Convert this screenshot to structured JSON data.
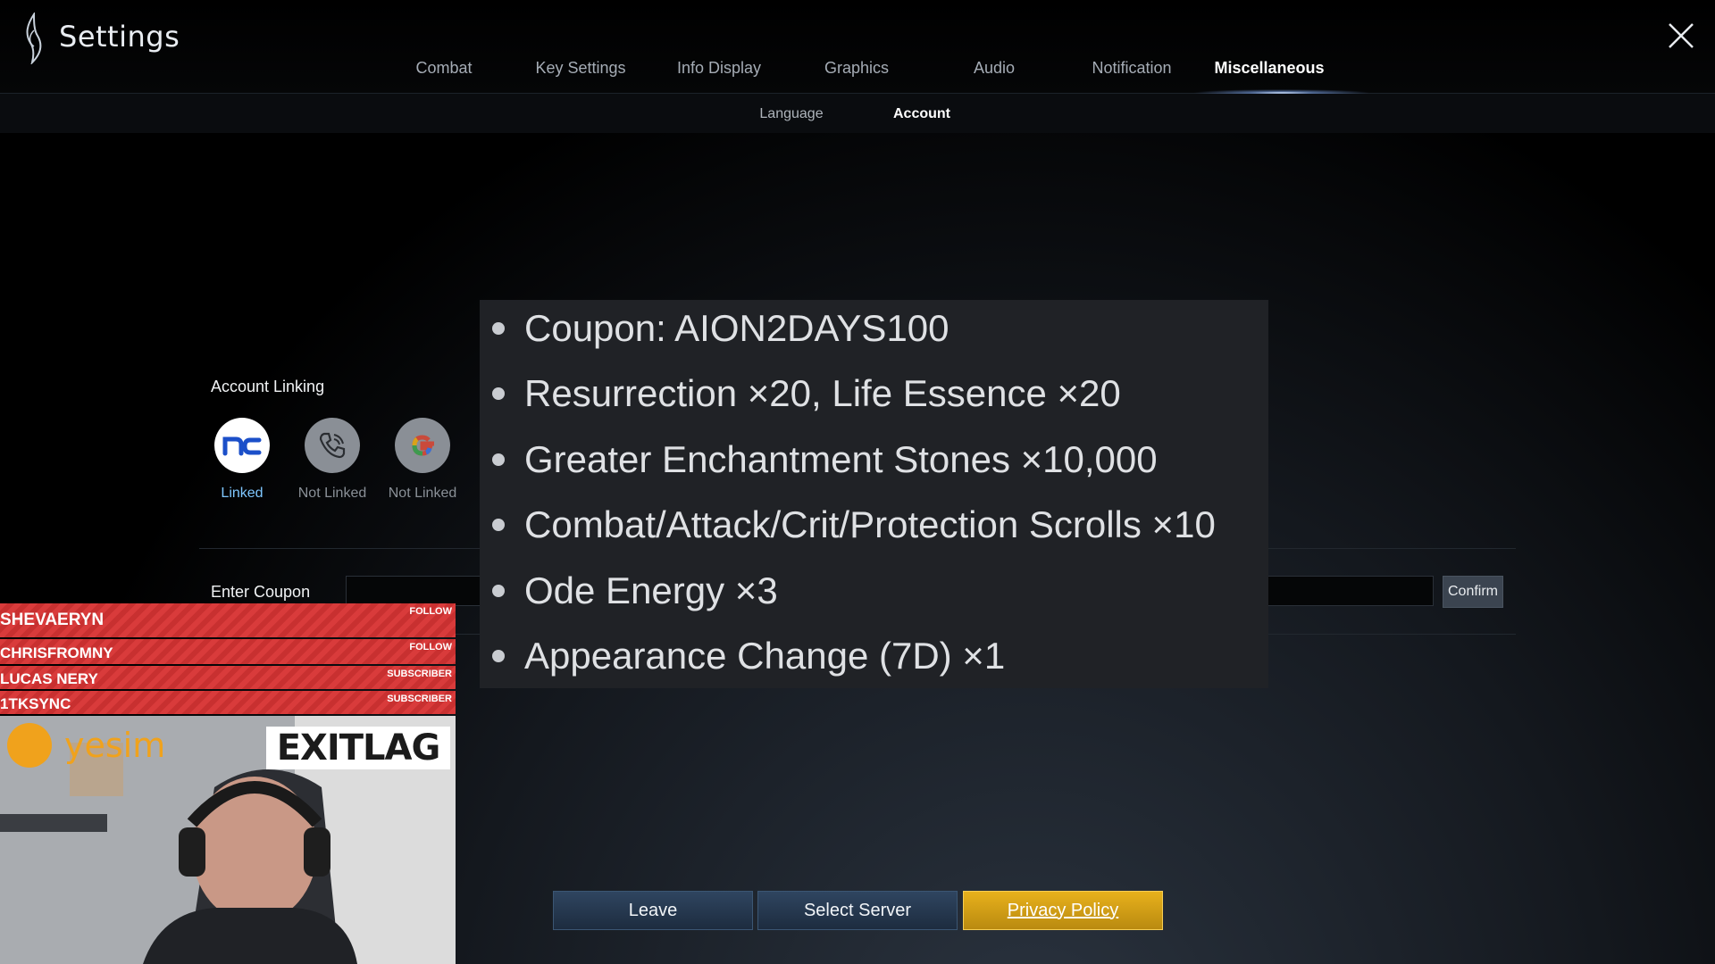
{
  "header": {
    "title": "Settings",
    "tabs": [
      {
        "label": "Combat"
      },
      {
        "label": "Key Settings"
      },
      {
        "label": "Info Display"
      },
      {
        "label": "Graphics"
      },
      {
        "label": "Audio"
      },
      {
        "label": "Notification"
      },
      {
        "label": "Miscellaneous",
        "active": true
      }
    ],
    "subtabs": [
      {
        "label": "Language"
      },
      {
        "label": "Account",
        "active": true
      }
    ]
  },
  "account": {
    "linking_label": "Account Linking",
    "links": [
      {
        "icon": "nc-logo-icon",
        "status": "Linked"
      },
      {
        "icon": "phone-icon",
        "status": "Not Linked"
      },
      {
        "icon": "google-icon",
        "status": "Not Linked"
      }
    ],
    "coupon_label": "Enter Coupon",
    "coupon_value": "",
    "confirm_label": "Confirm"
  },
  "overlay_rewards": [
    "Coupon: AION2DAYS100",
    "Resurrection ×20, Life Essence ×20",
    "Greater Enchantment Stones ×10,000",
    "Combat/Attack/Crit/Protection Scrolls ×10",
    "Ode Energy ×3",
    "Appearance Change (7D) ×1"
  ],
  "footer": {
    "leave_label": "Leave",
    "select_server_label": "Select Server",
    "privacy_label": "Privacy Policy"
  },
  "stream": {
    "alerts": [
      {
        "name": "SHEVAERYN",
        "tag": "FOLLOW"
      },
      {
        "name": "CHRISFROMNY",
        "tag": "FOLLOW"
      },
      {
        "name": "LUCAS NERY",
        "tag": "SUBSCRIBER"
      },
      {
        "name": "1TKSYNC",
        "tag": "SUBSCRIBER"
      }
    ],
    "sponsors": [
      "yesim",
      "EXITLAG"
    ]
  },
  "colors": {
    "linked": "#7fc7ff",
    "not_linked": "#8a9097",
    "gold_button": "#e0a81a",
    "dark_button": "#26384f",
    "alert_red": "#d93b3b"
  }
}
